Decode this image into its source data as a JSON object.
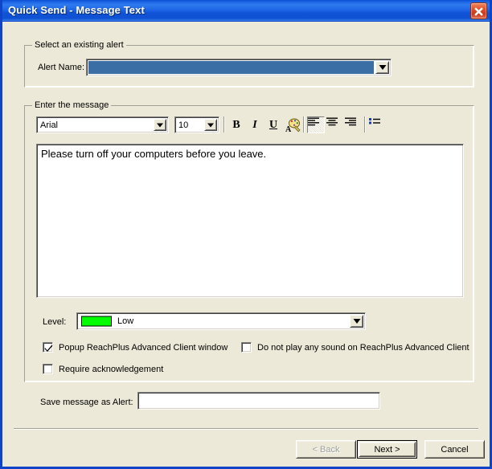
{
  "window": {
    "title": "Quick Send - Message Text",
    "close_icon": "close-icon",
    "accent_color": "#0f43c8",
    "face_color": "#ece9d8"
  },
  "alert_group": {
    "caption": "Select an existing alert",
    "alert_name_label": "Alert Name:",
    "alert_name_value": "",
    "alert_name_placeholder": "",
    "alert_name_selected_color": "#3a6ea5",
    "dropdown_icon": "chevron-down-icon"
  },
  "message_group": {
    "caption": "Enter the message",
    "toolbar": {
      "font_family_value": "Arial",
      "font_size_value": "10",
      "bold_label": "B",
      "italic_label": "I",
      "underline_label": "U",
      "font_color_icon": "font-color-palette-icon",
      "align_left_icon": "align-left-icon",
      "align_center_icon": "align-center-icon",
      "align_right_icon": "align-right-icon",
      "bullet_list_icon": "bullet-list-icon",
      "active_alignment": "left",
      "dropdown_icon": "chevron-down-icon"
    },
    "message_text": "Please turn off your computers before you leave.",
    "level_label": "Level:",
    "level_value": "Low",
    "level_swatch_color": "#00ff00",
    "checkboxes": [
      {
        "label": "Popup ReachPlus Advanced Client window",
        "checked": true
      },
      {
        "label": "Do not play any sound on ReachPlus Advanced Client",
        "checked": false
      },
      {
        "label": "Require acknowledgement",
        "checked": false
      }
    ]
  },
  "save_as": {
    "label": "Save message as Alert:",
    "value": "",
    "placeholder": ""
  },
  "footer": {
    "back_label": "< Back",
    "back_disabled": true,
    "next_label": "Next >",
    "next_is_default": true,
    "cancel_label": "Cancel"
  }
}
